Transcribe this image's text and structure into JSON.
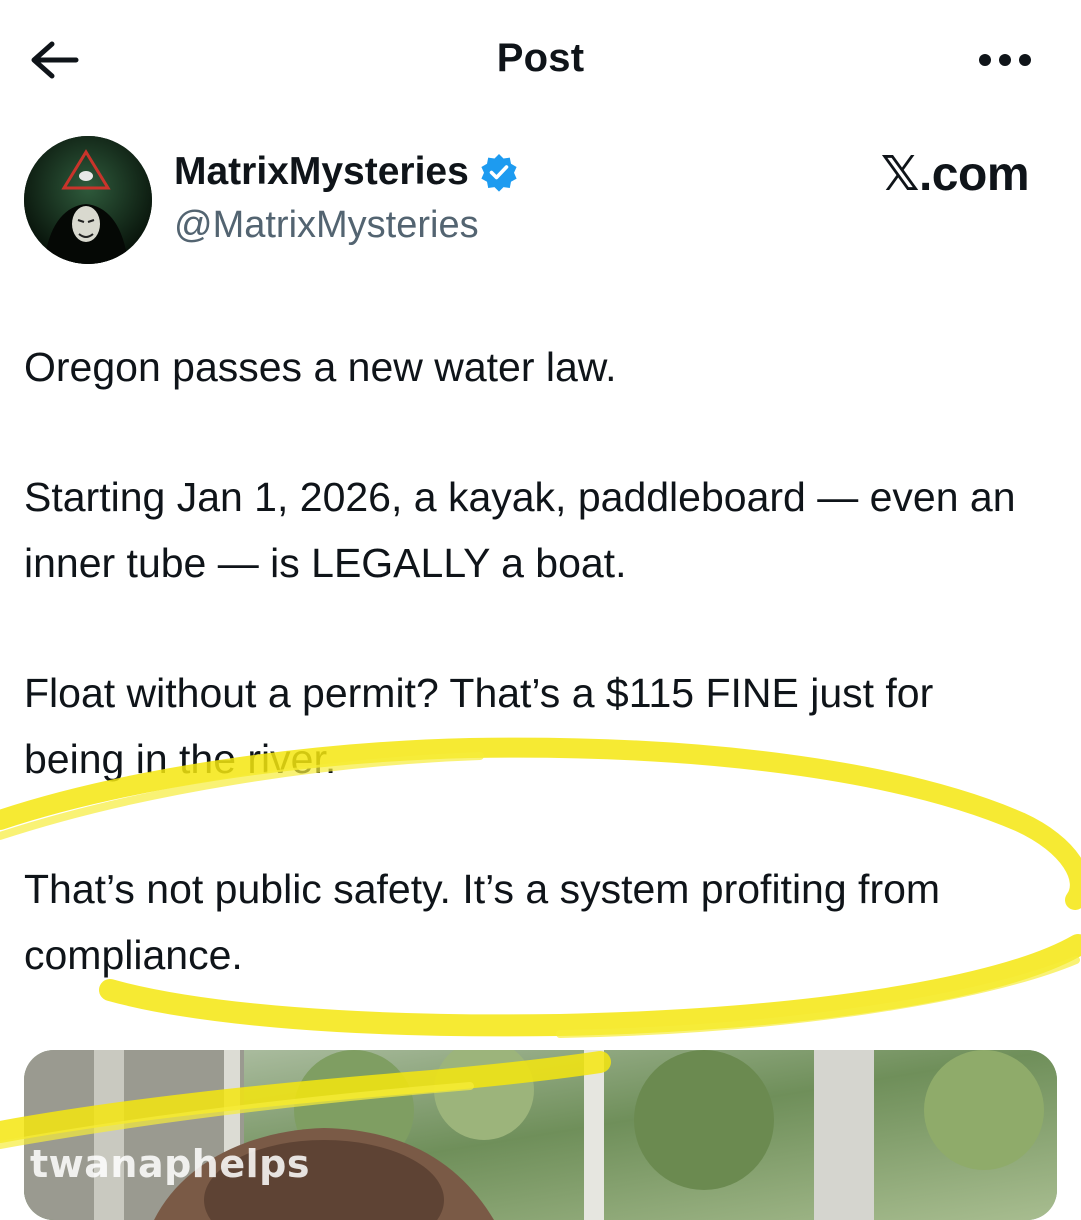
{
  "header": {
    "title": "Post"
  },
  "post": {
    "author": {
      "name": "MatrixMysteries",
      "handle": "@MatrixMysteries",
      "verified": true
    },
    "source": "𝕏.com",
    "paragraphs": [
      "Oregon passes a new water law.",
      "Starting Jan 1, 2026, a kayak, paddleboard — even an inner tube — is LEGALLY a boat.",
      "Float without a permit? That’s a $115 FINE just for being in the river.",
      "That’s not public safety. It’s a system profiting from compliance."
    ],
    "media": {
      "watermark": "twanaphelps"
    }
  },
  "colors": {
    "text": "#0f1419",
    "secondary_text": "#536471",
    "verified_blue": "#1d9bf0",
    "highlighter": "#f5e60f"
  }
}
